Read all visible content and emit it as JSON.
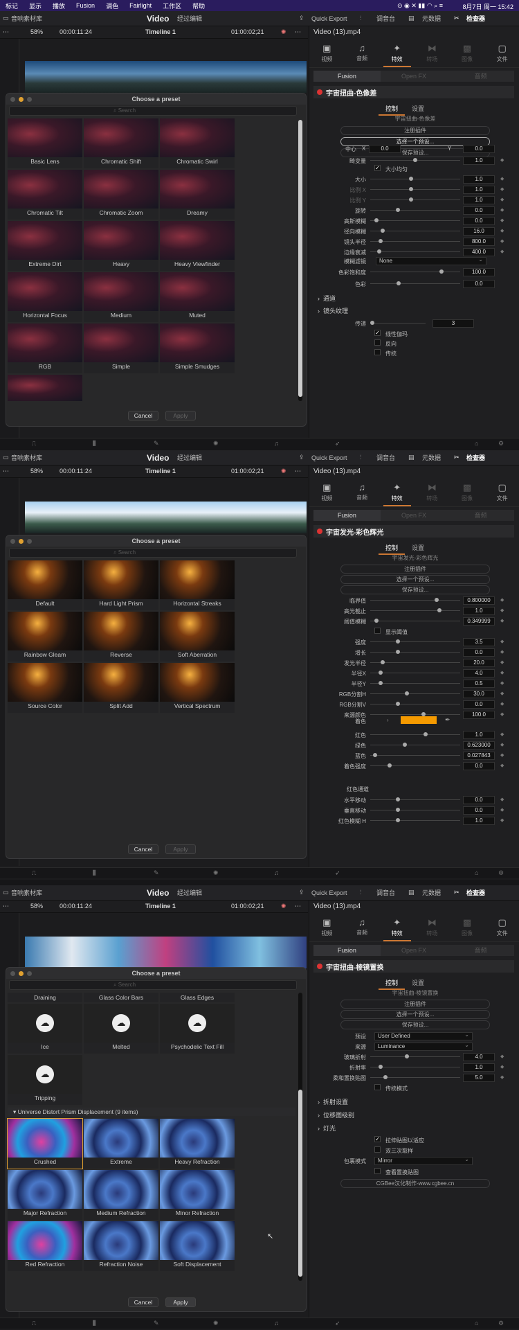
{
  "menubar": {
    "items": [
      "标记",
      "显示",
      "播放",
      "Fusion",
      "调色",
      "Fairlight",
      "工作区",
      "帮助"
    ],
    "clock": "8月7日 周一  15:42"
  },
  "pagebar": {
    "media": "音响素材库",
    "title": "Video",
    "title2": "经过编辑",
    "quick_export": "Quick Export",
    "mixer": "调音台",
    "metadata": "元数据",
    "inspector": "检查器"
  },
  "timeline": {
    "zoom": "58%",
    "tc_left": "00:00:11:24",
    "name": "Timeline 1",
    "tc_right": "01:00:02;21"
  },
  "inspector": {
    "clip": "Video (13).mp4",
    "tabs": [
      "视频",
      "音频",
      "特效",
      "转场",
      "图像",
      "文件"
    ],
    "fx_tabs": [
      "Fusion",
      "Open FX",
      "音频"
    ],
    "ctrl": "控制",
    "settings": "设置",
    "register": "注册插件",
    "choose": "选择一个预设...",
    "save": "保存预设..."
  },
  "dialog": {
    "title": "Choose a preset",
    "search": "Search",
    "cancel": "Cancel",
    "apply": "Apply"
  },
  "s1": {
    "fx": "宇宙扭曲-色像差",
    "sub": "宇宙扭曲-色像差",
    "center_label": "中心",
    "cx_label": "X",
    "cx": "0.0",
    "cy_label": "Y",
    "cy": "0.0",
    "params": [
      {
        "l": "畸变量",
        "v": "1.0",
        "k": 0.5
      },
      {
        "l": "大小",
        "v": "1.0",
        "k": 0.45
      },
      {
        "l": "比例 X",
        "v": "1.0",
        "k": 0.45
      },
      {
        "l": "比例 Y",
        "v": "1.0",
        "k": 0.45
      },
      {
        "l": "旋转",
        "v": "0.0",
        "k": 0.3
      },
      {
        "l": "高斯模糊",
        "v": "0.0",
        "k": 0.05
      },
      {
        "l": "径向模糊",
        "v": "16.0",
        "k": 0.12
      },
      {
        "l": "镜头半径",
        "v": "800.0",
        "k": 0.1
      },
      {
        "l": "边缘衰减",
        "v": "400.0",
        "k": 0.08
      }
    ],
    "uniform": "大小均匀",
    "blur_filter_label": "模糊滤镜",
    "blur_filter": "None",
    "sat_label": "色彩饱和度",
    "sat": "100.0",
    "hue_label": "色彩",
    "hue": "0.0",
    "sec1": "通道",
    "sec2": "镜头纹理",
    "passes_label": "传递",
    "passes": "3",
    "chk_linear": "线性伽玛",
    "chk_invert": "反向",
    "chk_legacy": "传统",
    "presets": [
      "Basic Lens",
      "Chromatic Shift",
      "Chromatic Swirl",
      "Chromatic Tilt",
      "Chromatic Zoom",
      "Dreamy",
      "Extreme Dirt",
      "Heavy",
      "Heavy Viewfinder",
      "Horizontal Focus",
      "Medium",
      "Muted",
      "RGB",
      "Simple",
      "Simple Smudges"
    ]
  },
  "s2": {
    "fx": "宇宙发光-彩色辉光",
    "sub": "宇宙发光-彩色辉光",
    "params": [
      {
        "l": "临界值",
        "v": "0.800000",
        "k": 0.75
      },
      {
        "l": "高光截止",
        "v": "1.0",
        "k": 0.78
      },
      {
        "l": "阈值模糊",
        "v": "0.349999",
        "k": 0.05
      }
    ],
    "show_thresh": "显示阈值",
    "params2": [
      {
        "l": "强度",
        "v": "3.5",
        "k": 0.3
      },
      {
        "l": "增长",
        "v": "0.0",
        "k": 0.3
      },
      {
        "l": "发光半径",
        "v": "20.0",
        "k": 0.12
      },
      {
        "l": "半径X",
        "v": "4.0",
        "k": 0.1
      },
      {
        "l": "半径Y",
        "v": "0.5",
        "k": 0.1
      },
      {
        "l": "RGB分割H",
        "v": "30.0",
        "k": 0.4
      },
      {
        "l": "RGB分割V",
        "v": "0.0",
        "k": 0.3
      },
      {
        "l": "来源颜色",
        "v": "100.0",
        "k": 0.6
      }
    ],
    "tint_label": "着色",
    "params3": [
      {
        "l": "红色",
        "v": "1.0",
        "k": 0.62
      },
      {
        "l": "绿色",
        "v": "0.623000",
        "k": 0.38
      },
      {
        "l": "蓝色",
        "v": "0.027843",
        "k": 0.03
      },
      {
        "l": "着色强度",
        "v": "0.0",
        "k": 0.2
      }
    ],
    "red_channel": "红色通道",
    "params4": [
      {
        "l": "水平移动",
        "v": "0.0",
        "k": 0.3
      },
      {
        "l": "垂直移动",
        "v": "0.0",
        "k": 0.3
      },
      {
        "l": "红色模糊 H",
        "v": "1.0",
        "k": 0.3
      }
    ],
    "tint_color": "#f59a00",
    "presets": [
      "Default",
      "Hard Light Prism",
      "Horizontal Streaks",
      "Rainbow Gleam",
      "Reverse",
      "Soft Aberration",
      "Source Color",
      "Split Add",
      "Vertical Spectrum"
    ]
  },
  "s3": {
    "fx": "宇宙扭曲-棱镜置换",
    "sub": "宇宙扭曲-棱镜置换",
    "preset_label": "预设",
    "preset": "User Defined",
    "source_label": "来源",
    "source": "Luminance",
    "params": [
      {
        "l": "玻璃折射",
        "v": "4.0",
        "k": 0.4
      },
      {
        "l": "折射率",
        "v": "1.0",
        "k": 0.1
      },
      {
        "l": "柔和置换贴图",
        "v": "5.0",
        "k": 0.15
      }
    ],
    "legacy": "传统模式",
    "sec1": "折射设置",
    "sec2": "位移图级别",
    "sec3": "灯光",
    "chk_fit": "拉伸贴图以适应",
    "chk_cubic": "双三次取样",
    "wrap_label": "包裹模式",
    "wrap": "Mirror",
    "view_map": "查看置换贴图",
    "credit": "CGBee汉化制作-www.cgbee.cn",
    "top_row": [
      "Draining",
      "Glass Color Bars",
      "Glass Edges"
    ],
    "row2": [
      "Ice",
      "Melted",
      "Psychodelic Text Fill"
    ],
    "row3": [
      "Tripping"
    ],
    "group": "Universe Distort Prism Displacement (9 items)",
    "presets": [
      "Crushed",
      "Extreme",
      "Heavy Refraction",
      "Major Refraction",
      "Medium Refraction",
      "Minor Refraction",
      "Red Refraction",
      "Refraction Noise",
      "Soft Displacement"
    ]
  }
}
